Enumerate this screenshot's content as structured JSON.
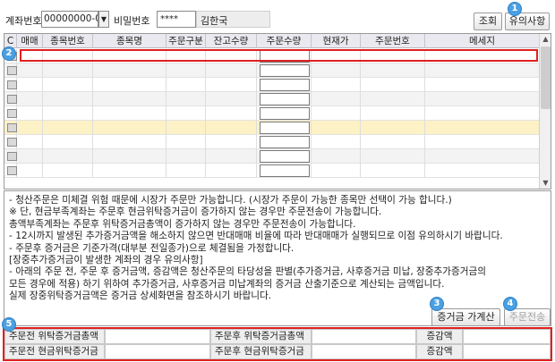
{
  "header": {
    "account_label": "계좌번호",
    "account_value": "00000000-00",
    "password_label": "비밀번호",
    "password_value": "****",
    "account_name": "김한국",
    "query_button": "조회",
    "notice_button": "유의사항"
  },
  "markers": [
    "1",
    "2",
    "3",
    "4",
    "5"
  ],
  "grid": {
    "columns": [
      "C",
      "매매",
      "종목번호",
      "종목명",
      "주문구분",
      "잔고수량",
      "주문수량",
      "현재가",
      "주문번호",
      "메세지"
    ]
  },
  "notes": [
    "- 청산주문은 미체결 위험 때문에 시장가 주문만 가능합니다. (시장가 주문이 가능한 종목만 선택이 가능 합니다.)",
    "  ※ 단, 현금부족계좌는 주문후 현금위탁증거금이 증가하지 않는 경우만 주문전송이 가능합니다.",
    "       총액부족계좌는 주문후 위탁증거금총액이 증가하지 않는 경우만 주문전송이 가능합니다.",
    "- 12시까지 발생된 추가증거금액을 해소하지 않으면 반대매매 비율에 따라 반대매매가 실행되므로 이점 유의하시기 바랍니다.",
    "- 주문후 증거금은 기준가격(대부분 전일종가)으로 체결됨을 가정합니다.",
    "",
    "[장중추가증거금이 발생한 계좌의 경우 유의사항]",
    "- 아래의 주문 전, 주문 후 증거금액, 증감액은 청산주문의 타당성을 판별(추가증거금, 사후증거금 미납, 장중추가증거금의",
    "   모든 경우에 적용) 하기 위하여 추가증거금, 사후증거금 미납계좌의 증거금 산출기준으로 계산되는 금액입니다.",
    "   실제 장중위탁증거금액은 증거금 상세화면을 참조하시기 바랍니다."
  ],
  "actions": {
    "calc_button": "증거금 가계산",
    "send_button": "주문전송"
  },
  "summary": {
    "row1": [
      "주문전 위탁증거금총액",
      "주문후 위탁증거금총액",
      "증감액"
    ],
    "row2": [
      "주문전 현금위탁증거금",
      "주문후 현금위탁증거금",
      "증감액"
    ]
  },
  "colors": {
    "highlight_red": "#e02020",
    "marker_blue": "#4aa0e2",
    "selected_row": "#fdf1c6"
  }
}
